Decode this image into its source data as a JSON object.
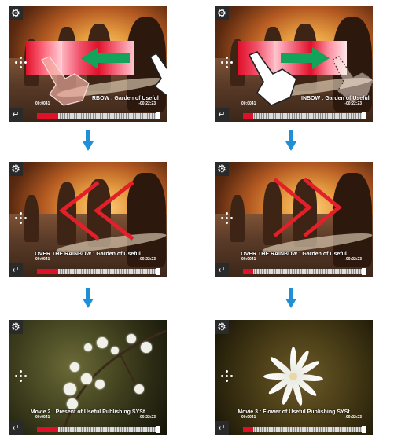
{
  "colors": {
    "accent_red": "#e0102a",
    "arrow_green": "#13a35b",
    "chevron_red": "#e3202a",
    "flow_blue": "#1f8fd6"
  },
  "screens": [
    {
      "title": "",
      "time_elapsed": "00:0041",
      "time_remaining": "-00:22:23",
      "progress": 0.17,
      "gesture": "swipe-left"
    },
    {
      "title": "",
      "time_elapsed": "00:0041",
      "time_remaining": "-00:22:23",
      "progress": 0.08,
      "gesture": "swipe-right"
    },
    {
      "title": "OVER THE RAINBOW : Garden of Useful",
      "time_elapsed": "00:0041",
      "time_remaining": "-00:22:23",
      "progress": 0.17
    },
    {
      "title": "OVER THE RAINBOW : Garden of Useful",
      "time_elapsed": "00:0041",
      "time_remaining": "-00:22:23",
      "progress": 0.08
    },
    {
      "title": "Movie 2 : Present of Useful Publishing SYSt",
      "time_elapsed": "00:0041",
      "time_remaining": "-00:22:23",
      "progress": 0.17
    },
    {
      "title": "Movie 3 : Flower of Useful Publishing SYSt",
      "time_elapsed": "00:0041",
      "time_remaining": "-00:22:23",
      "progress": 0.08
    }
  ],
  "partial_titles": {
    "left": "RBOW : Garden of Useful",
    "right": "INBOW : Garden of Useful"
  }
}
